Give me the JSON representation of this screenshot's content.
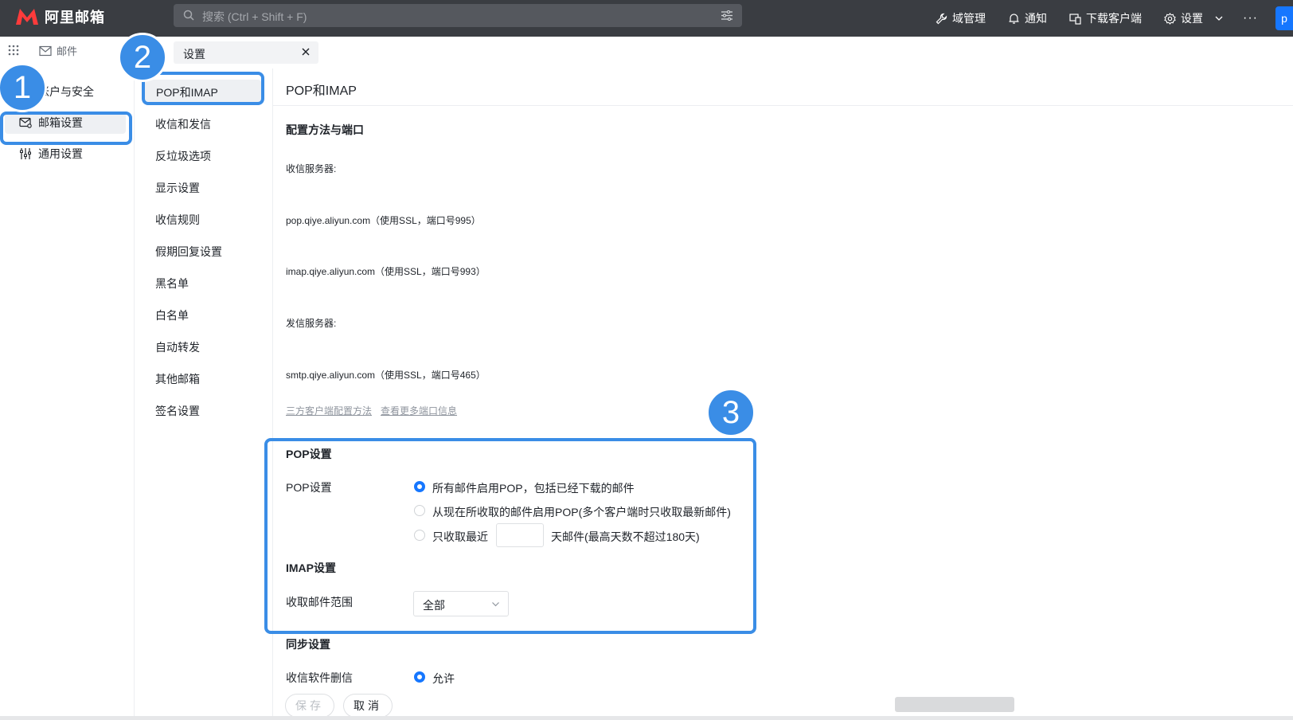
{
  "app": {
    "name": "阿里邮箱",
    "avatar_letter": "p"
  },
  "search": {
    "placeholder": "搜索 (Ctrl + Shift + F)"
  },
  "top_actions": [
    {
      "label": "域管理",
      "icon": "wrench-icon"
    },
    {
      "label": "通知",
      "icon": "bell-icon"
    },
    {
      "label": "下载客户端",
      "icon": "devices-icon"
    },
    {
      "label": "设置",
      "icon": "gear-icon"
    }
  ],
  "more_label": "···",
  "app_switch": {
    "mail_label": "邮件"
  },
  "tab": {
    "label": "设置"
  },
  "nav1": [
    {
      "label": "账户与安全",
      "icon": "user-shield-icon"
    },
    {
      "label": "邮箱设置",
      "icon": "mailbox-settings-icon",
      "active": true
    },
    {
      "label": "通用设置",
      "icon": "sliders-icon"
    }
  ],
  "nav2": [
    "POP和IMAP",
    "收信和发信",
    "反垃圾选项",
    "显示设置",
    "收信规则",
    "假期回复设置",
    "黑名单",
    "白名单",
    "自动转发",
    "其他邮箱",
    "签名设置"
  ],
  "main": {
    "title": "POP和IMAP",
    "config_title": "配置方法与端口",
    "incoming_label": "收信服务器:",
    "pop_server": "pop.qiye.aliyun.com（使用SSL，端口号995）",
    "imap_server": "imap.qiye.aliyun.com（使用SSL，端口号993）",
    "outgoing_label": "发信服务器:",
    "smtp_server": "smtp.qiye.aliyun.com（使用SSL，端口号465）",
    "link_client": "三方客户端配置方法",
    "link_ports": "查看更多端口信息",
    "pop_section": "POP设置",
    "pop_label": "POP设置",
    "pop_options": [
      "所有邮件启用POP，包括已经下载的邮件",
      "从现在所收取的邮件启用POP(多个客户端时只收取最新邮件)",
      "只收取最近"
    ],
    "pop_selected": 0,
    "pop_days_suffix": "天邮件(最高天数不超过180天)",
    "imap_section": "IMAP设置",
    "imap_label": "收取邮件范围",
    "imap_range": "全部",
    "sync_section": "同步设置",
    "sync_label": "收信软件删信",
    "sync_option": "允许",
    "save_label": "保存",
    "cancel_label": "取消"
  },
  "annotations": [
    "1",
    "2",
    "3"
  ],
  "colors": {
    "topbar": "#3a3d42",
    "accent": "#1677ff",
    "annotation": "#3a8de6"
  }
}
